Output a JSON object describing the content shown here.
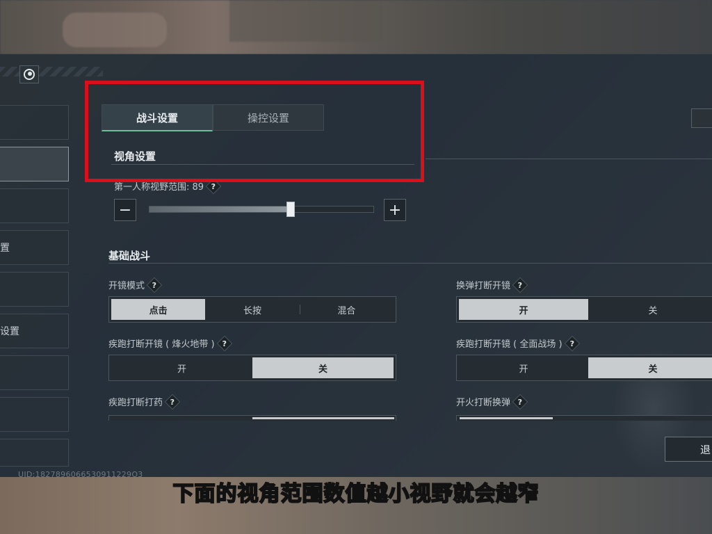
{
  "header": {},
  "sidebar": {
    "items": [
      {
        "label": ""
      },
      {
        "label": ""
      },
      {
        "label": ""
      },
      {
        "label": "置"
      },
      {
        "label": ""
      },
      {
        "label": "设置"
      },
      {
        "label": ""
      },
      {
        "label": ""
      },
      {
        "label": ""
      }
    ],
    "active_index": 1
  },
  "uid": "UID:1827896066530911229O3",
  "tabs": [
    {
      "label": "战斗设置",
      "active": true
    },
    {
      "label": "操控设置",
      "active": false
    }
  ],
  "exit_button": {
    "label": "退"
  },
  "view_section": {
    "title": "视角设置",
    "fov_label": "第一人称视野范围: 89",
    "help_glyph": "?",
    "fov_fraction": 0.63,
    "minus": "−",
    "plus": "+"
  },
  "basic_section": {
    "title": "基础战斗",
    "settings": [
      {
        "label": "开镜模式",
        "options": [
          "点击",
          "长按",
          "混合"
        ],
        "selected": 0
      },
      {
        "label": "换弹打断开镜",
        "options": [
          "开",
          "关"
        ],
        "selected": 0
      },
      {
        "label": "疾跑打断开镜 ( 烽火地带 )",
        "options": [
          "开",
          "关"
        ],
        "selected": 1
      },
      {
        "label": "疾跑打断开镜 ( 全面战场 )",
        "options": [
          "开",
          "关"
        ],
        "selected": 1
      },
      {
        "label": "疾跑打断打药"
      },
      {
        "label": "开火打断换弹"
      }
    ]
  },
  "subtitle": "下面的视角范围数值越小视野就会越窄",
  "colors": {
    "highlight_box": "#d9101c",
    "subtitle": "#ffe400",
    "tab_accent": "#6fbf9a"
  }
}
